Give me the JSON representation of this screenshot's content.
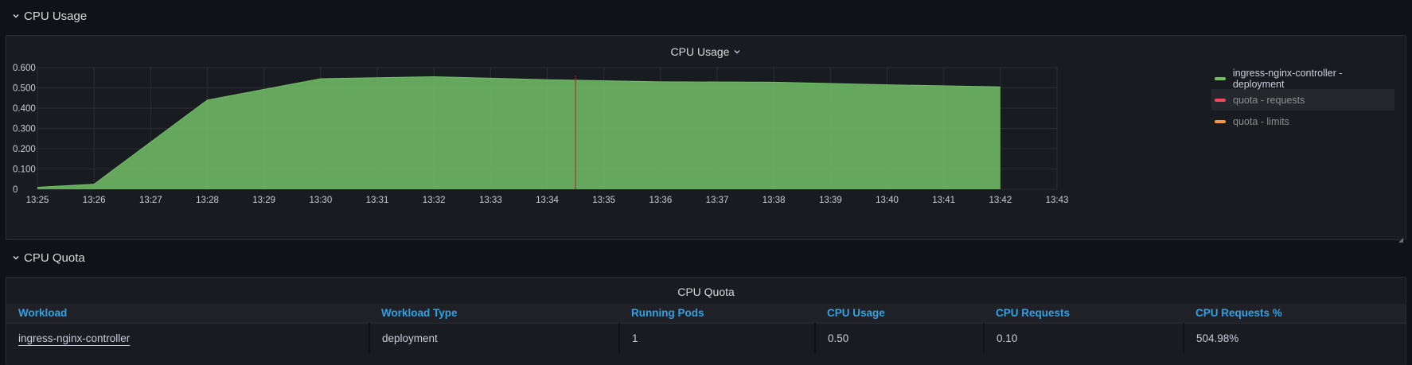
{
  "rows": {
    "cpu_usage": {
      "title": "CPU Usage"
    },
    "cpu_quota": {
      "title": "CPU Quota"
    }
  },
  "usage_panel": {
    "title": "CPU Usage",
    "legend": [
      {
        "label": "ingress-nginx-controller - deployment",
        "color": "#73bf69"
      },
      {
        "label": "quota - requests",
        "color": "#f2495c"
      },
      {
        "label": "quota - limits",
        "color": "#ff9830"
      }
    ]
  },
  "quota_panel": {
    "title": "CPU Quota",
    "columns": [
      "Workload",
      "Workload Type",
      "Running Pods",
      "CPU Usage",
      "CPU Requests",
      "CPU Requests %"
    ],
    "rows": [
      [
        "ingress-nginx-controller",
        "deployment",
        "1",
        "0.50",
        "0.10",
        "504.98%"
      ]
    ]
  },
  "chart_data": {
    "type": "area",
    "title": "CPU Usage",
    "y_ticks": [
      "0",
      "0.100",
      "0.200",
      "0.300",
      "0.400",
      "0.500",
      "0.600"
    ],
    "ylim": [
      0,
      0.6
    ],
    "x_ticks": [
      "13:25",
      "13:26",
      "13:27",
      "13:28",
      "13:29",
      "13:30",
      "13:31",
      "13:32",
      "13:33",
      "13:34",
      "13:35",
      "13:36",
      "13:37",
      "13:38",
      "13:39",
      "13:40",
      "13:41",
      "13:42",
      "13:43"
    ],
    "xlim": [
      "13:25",
      "13:43"
    ],
    "grid": true,
    "legend_position": "right",
    "series": [
      {
        "name": "ingress-nginx-controller - deployment",
        "color": "#73bf69",
        "x": [
          "13:25",
          "13:26",
          "13:28",
          "13:30",
          "13:32",
          "13:34",
          "13:36",
          "13:38",
          "13:40",
          "13:42"
        ],
        "values": [
          0.01,
          0.025,
          0.44,
          0.545,
          0.555,
          0.54,
          0.53,
          0.528,
          0.515,
          0.505
        ]
      }
    ],
    "annotations": [
      {
        "type": "vertical-line",
        "x": "13:34.5",
        "color": "#c4162a"
      }
    ]
  }
}
